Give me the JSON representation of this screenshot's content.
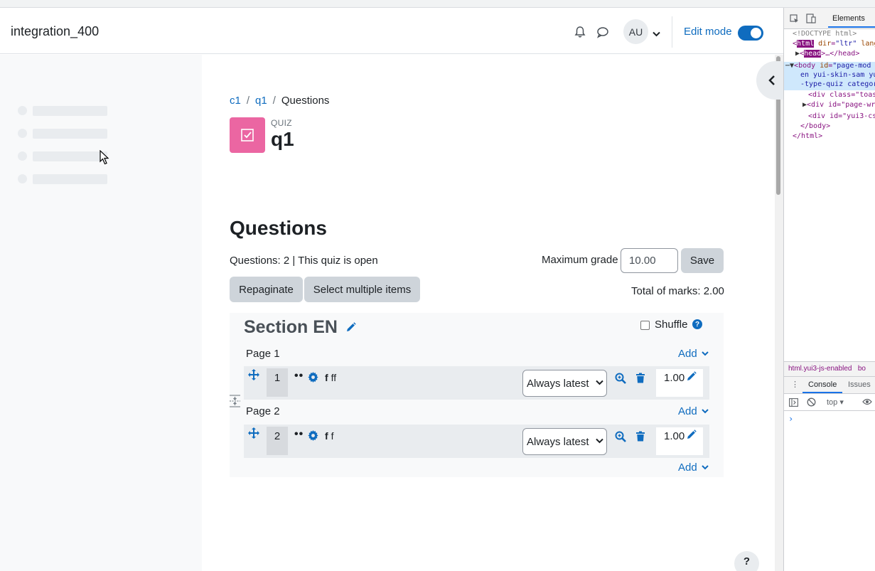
{
  "navbar": {
    "site_name": "integration_400",
    "avatar_initials": "AU",
    "edit_mode_label": "Edit mode",
    "edit_mode_on": true
  },
  "breadcrumb": {
    "items": [
      "c1",
      "q1",
      "Questions"
    ]
  },
  "activity": {
    "type_label": "QUIZ",
    "title": "q1",
    "icon_color": "#eb66a2"
  },
  "questions": {
    "heading": "Questions",
    "info": "Questions: 2 | This quiz is open",
    "max_grade_label": "Maximum grade",
    "max_grade_value": "10.00",
    "save_label": "Save",
    "repaginate_label": "Repaginate",
    "select_multiple_label": "Select multiple items",
    "total_marks": "Total of marks: 2.00"
  },
  "section": {
    "title": "Section EN",
    "shuffle_label": "Shuffle",
    "shuffle_checked": false,
    "help_glyph": "?",
    "pages": [
      {
        "label": "Page 1",
        "add_label": "Add",
        "question": {
          "number": "1",
          "dots": "••",
          "type_glyph": "f",
          "name": "ff",
          "version": "Always latest",
          "mark": "1.00"
        }
      },
      {
        "label": "Page 2",
        "add_label": "Add",
        "question": {
          "number": "2",
          "dots": "••",
          "type_glyph": "f",
          "name": "f",
          "version": "Always latest",
          "mark": "1.00"
        }
      }
    ],
    "final_add_label": "Add"
  },
  "help_float": "?",
  "devtools": {
    "tab_elements": "Elements",
    "lines": {
      "doctype": "<!DOCTYPE html>",
      "html_open_tag": "html",
      "html_attr": "dir",
      "html_val": "\"ltr\"",
      "html_more": "lang",
      "head_tag": "head",
      "head_rest": "…</head>",
      "body_tag": "<body",
      "body_attr": "id",
      "body_val": "\"page-mod",
      "body_line2": "en yui-skin-sam yu",
      "body_line3": "-type-quiz categor",
      "div1": "<div class=\"toas",
      "div2": "<div id=\"page-wr",
      "div3": "<div id=\"yui3-cs",
      "body_close": "</body>",
      "html_close": "</html>"
    },
    "crumb": "html.yui3-js-enabled",
    "crumb_more": "bo",
    "console_tab": "Console",
    "issues_tab": "Issues",
    "context": "top",
    "prompt": "›"
  },
  "colors": {
    "link": "#0f6cbf",
    "button_grey": "#ced4da"
  }
}
